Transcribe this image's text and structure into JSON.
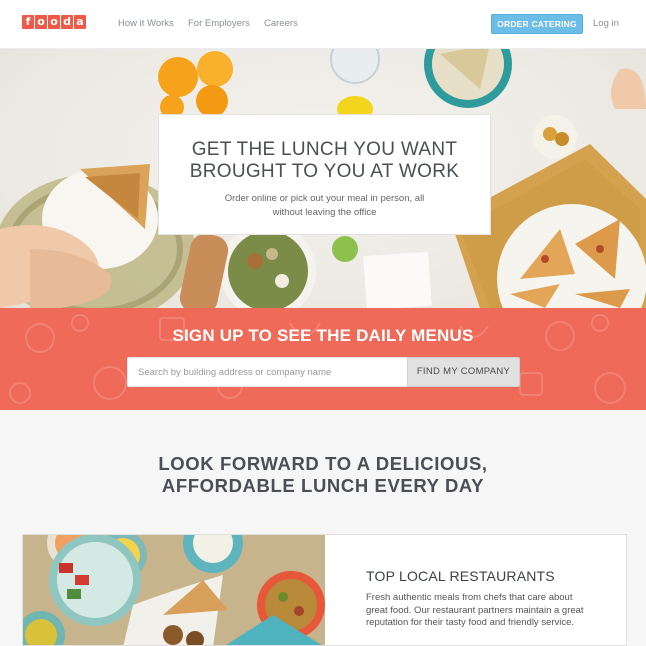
{
  "brand": {
    "logo_letters": [
      "f",
      "o",
      "o",
      "d",
      "a"
    ],
    "accent": "#ef5a48"
  },
  "nav": {
    "links": [
      "How it Works",
      "For Employers",
      "Careers"
    ],
    "cta_label": "ORDER CATERING",
    "login_label": "Log in"
  },
  "hero": {
    "title": "GET THE LUNCH YOU WANT BROUGHT TO YOU AT WORK",
    "subtitle": "Order online or pick out your meal in person, all without leaving the office"
  },
  "signup": {
    "title": "SIGN UP TO SEE THE DAILY MENUS",
    "search_placeholder": "Search by building address or company name",
    "button_label": "FIND MY COMPANY",
    "band_color": "#ef6a58"
  },
  "section": {
    "headline": "LOOK FORWARD TO A DELICIOUS, AFFORDABLE LUNCH EVERY DAY"
  },
  "feature": {
    "title": "TOP LOCAL RESTAURANTS",
    "body": "Fresh authentic meals from chefs that care about great food. Our restaurant partners maintain a great reputation for their tasty food and friendly service."
  }
}
